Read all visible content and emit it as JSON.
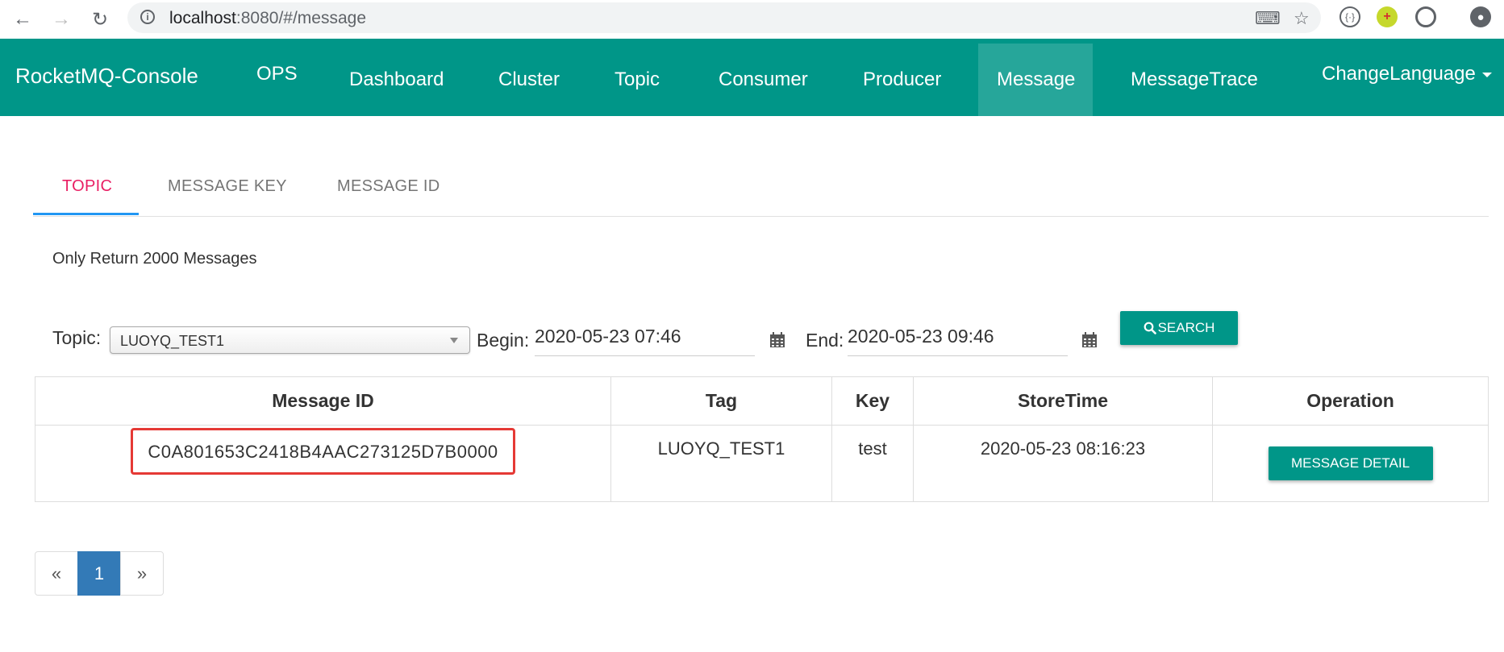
{
  "browser": {
    "url_host": "localhost",
    "url_rest": ":8080/#/message"
  },
  "navbar": {
    "brand": "RocketMQ-Console",
    "items": [
      {
        "label": "OPS"
      },
      {
        "label": "Dashboard"
      },
      {
        "label": "Cluster"
      },
      {
        "label": "Topic"
      },
      {
        "label": "Consumer"
      },
      {
        "label": "Producer"
      },
      {
        "label": "Message"
      },
      {
        "label": "MessageTrace"
      },
      {
        "label": "ChangeLanguage"
      }
    ],
    "active": "Message"
  },
  "tabs": [
    {
      "label": "TOPIC"
    },
    {
      "label": "MESSAGE KEY"
    },
    {
      "label": "MESSAGE ID"
    }
  ],
  "active_tab": "TOPIC",
  "note": "Only Return 2000 Messages",
  "search": {
    "topic_label": "Topic:",
    "topic_value": "LUOYQ_TEST1",
    "begin_label": "Begin:",
    "begin_value": "2020-05-23 07:46",
    "end_label": "End:",
    "end_value": "2020-05-23 09:46",
    "search_label": "SEARCH"
  },
  "table": {
    "headers": [
      "Message ID",
      "Tag",
      "Key",
      "StoreTime",
      "Operation"
    ],
    "rows": [
      {
        "message_id": "C0A801653C2418B4AAC273125D7B0000",
        "tag": "LUOYQ_TEST1",
        "key": "test",
        "store_time": "2020-05-23 08:16:23",
        "operation": "MESSAGE DETAIL"
      }
    ]
  },
  "pagination": {
    "prev": "«",
    "current": "1",
    "next": "»"
  },
  "colors": {
    "primary": "#009688",
    "active_tab": "#e91e63",
    "tab_ink": "#2196f3",
    "highlight_box": "#e53935",
    "page_current": "#337ab7"
  }
}
